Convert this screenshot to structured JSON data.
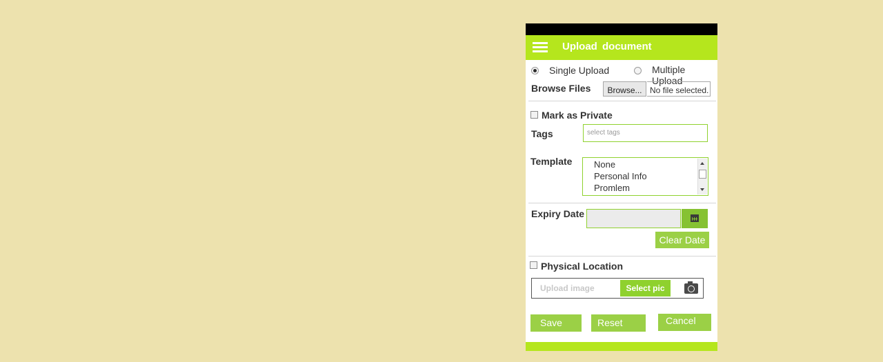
{
  "header": {
    "title": "Upload document"
  },
  "upload_mode": {
    "options": [
      "Single Upload",
      "Multiple Upload"
    ],
    "selected": "Single Upload"
  },
  "browse": {
    "label": "Browse Files",
    "button_label": "Browse...",
    "file_status": "No file selected."
  },
  "private": {
    "label": "Mark as Private",
    "checked": false
  },
  "tags": {
    "label": "Tags",
    "placeholder": "select tags"
  },
  "template": {
    "label": "Template",
    "options": [
      "None",
      "Personal Info",
      "Promlem"
    ]
  },
  "expiry": {
    "label": "Expiry Date",
    "value": "",
    "clear_label": "Clear Date"
  },
  "physical_location": {
    "label": "Physical Location",
    "checked": false
  },
  "image_upload": {
    "placeholder": "Upload image",
    "select_label": "Select pic"
  },
  "actions": {
    "save": "Save",
    "reset": "Reset",
    "cancel": "Cancel"
  },
  "colors": {
    "background": "#ede2ae",
    "header": "#b5e61d",
    "button": "#9bd046",
    "status_bar": "#000000"
  },
  "icons": [
    "menu-icon",
    "calendar-icon",
    "camera-icon"
  ]
}
